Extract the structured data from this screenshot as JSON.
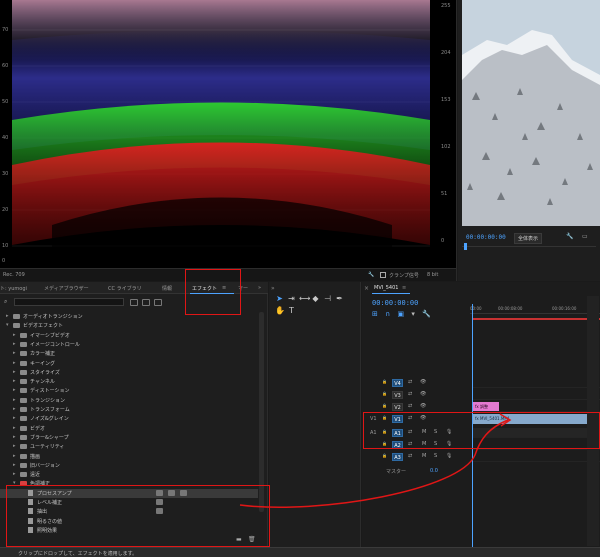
{
  "scope": {
    "left_scale": [
      "70",
      "60",
      "50",
      "40",
      "30",
      "20",
      "10",
      "0"
    ],
    "right_scale": [
      "255",
      "204",
      "153",
      "102",
      "51",
      "0"
    ],
    "footer_left": "Rec. 709",
    "footer_right": "クランプ信号",
    "bit_depth": "8 bit"
  },
  "program": {
    "timecode": "00:00:00:00",
    "fit_label": "全体表示"
  },
  "effects_panel": {
    "tabs": [
      {
        "label": "ト: yumogi"
      },
      {
        "label": "メディアブラウザー"
      },
      {
        "label": "CC ライブラリ"
      },
      {
        "label": "情報"
      },
      {
        "label": "エフェクト"
      },
      {
        "label": "マー"
      }
    ],
    "tree": [
      {
        "label": "オーディオトランジション",
        "level": 0,
        "expanded": false,
        "kind": "folder"
      },
      {
        "label": "ビデオエフェクト",
        "level": 0,
        "expanded": true,
        "kind": "folder"
      },
      {
        "label": "イマーシブビデオ",
        "level": 1,
        "expanded": false,
        "kind": "folder"
      },
      {
        "label": "イメージコントロール",
        "level": 1,
        "expanded": false,
        "kind": "folder"
      },
      {
        "label": "カラー補正",
        "level": 1,
        "expanded": false,
        "kind": "folder"
      },
      {
        "label": "キーイング",
        "level": 1,
        "expanded": false,
        "kind": "folder"
      },
      {
        "label": "スタイライズ",
        "level": 1,
        "expanded": false,
        "kind": "folder"
      },
      {
        "label": "チャンネル",
        "level": 1,
        "expanded": false,
        "kind": "folder"
      },
      {
        "label": "ディストーション",
        "level": 1,
        "expanded": false,
        "kind": "folder"
      },
      {
        "label": "トランジション",
        "level": 1,
        "expanded": false,
        "kind": "folder"
      },
      {
        "label": "トランスフォーム",
        "level": 1,
        "expanded": false,
        "kind": "folder"
      },
      {
        "label": "ノイズ&グレイン",
        "level": 1,
        "expanded": false,
        "kind": "folder"
      },
      {
        "label": "ビデオ",
        "level": 1,
        "expanded": false,
        "kind": "folder"
      },
      {
        "label": "ブラー&シャープ",
        "level": 1,
        "expanded": false,
        "kind": "folder"
      },
      {
        "label": "ユーティリティ",
        "level": 1,
        "expanded": false,
        "kind": "folder"
      },
      {
        "label": "描画",
        "level": 1,
        "expanded": false,
        "kind": "folder"
      },
      {
        "label": "旧バージョン",
        "level": 1,
        "expanded": false,
        "kind": "folder"
      },
      {
        "label": "遠近",
        "level": 1,
        "expanded": false,
        "kind": "folder"
      },
      {
        "label": "色調補正",
        "level": 1,
        "expanded": true,
        "kind": "folder-red"
      },
      {
        "label": "プロセスアンプ",
        "level": 2,
        "kind": "effect",
        "selected": true,
        "badges": 3
      },
      {
        "label": "レベル補正",
        "level": 2,
        "kind": "effect",
        "badges": 1
      },
      {
        "label": "抽出",
        "level": 2,
        "kind": "effect",
        "badges": 1
      },
      {
        "label": "明るさの値",
        "level": 2,
        "kind": "effect",
        "badges": 0
      },
      {
        "label": "照明効果",
        "level": 2,
        "kind": "effect",
        "badges": 0
      }
    ]
  },
  "timeline": {
    "sequence_name": "MVI_5401",
    "timecode": "00:00:00:00",
    "ruler": [
      "00:00",
      "00:00:08:00",
      "00:00:16:00"
    ],
    "tracks": [
      {
        "name": "V4",
        "source": "",
        "on": true,
        "kind": "video"
      },
      {
        "name": "V3",
        "source": "",
        "on": false,
        "kind": "video"
      },
      {
        "name": "V2",
        "source": "",
        "on": false,
        "kind": "video"
      },
      {
        "name": "V1",
        "source": "V1",
        "on": true,
        "kind": "video"
      },
      {
        "name": "A1",
        "source": "A1",
        "on": true,
        "kind": "audio"
      },
      {
        "name": "A2",
        "source": "",
        "on": true,
        "kind": "audio"
      },
      {
        "name": "A3",
        "source": "",
        "on": true,
        "kind": "audio"
      }
    ],
    "track_toggle_m": "M",
    "track_toggle_s": "S",
    "clip_fx_label": "fx 調整",
    "clip_v1_label": "fx MVI_5401.MP4",
    "master_label": "マスター",
    "master_value": "0.0"
  },
  "status": {
    "message": "クリップにドロップして、エフェクトを適用します。"
  },
  "colors": {
    "accent": "#4da3ff",
    "annotation": "#e01616",
    "clip_video": "#86a9cc",
    "clip_adjust": "#e37ad1",
    "folder_highlight": "#d94040"
  }
}
